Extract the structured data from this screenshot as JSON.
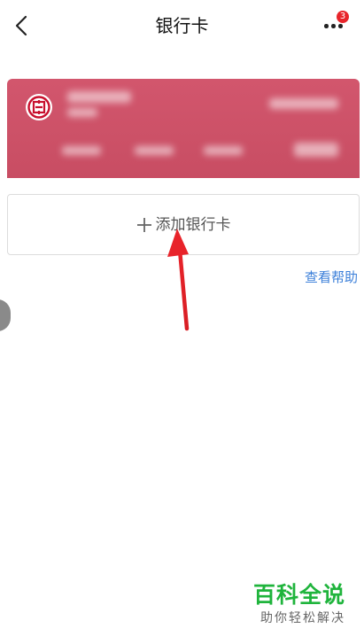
{
  "header": {
    "title": "银行卡",
    "back_icon": "chevron-left-icon",
    "more_icon": "more-dots-icon",
    "notification_count": "3",
    "badge_color": "#e8252b"
  },
  "bank_card": {
    "color": "#cc5167",
    "logo_icon": "icbc-bank-logo-icon",
    "details_blurred": true
  },
  "add_card": {
    "label": "添加银行卡",
    "icon": "plus-icon"
  },
  "help": {
    "label": "查看帮助",
    "color": "#3b7fd9"
  },
  "watermark": {
    "title": "百科全说",
    "subtitle": "助你轻松解决",
    "color": "#1fb43c"
  },
  "annotation": {
    "arrow_color": "#e8232a"
  }
}
